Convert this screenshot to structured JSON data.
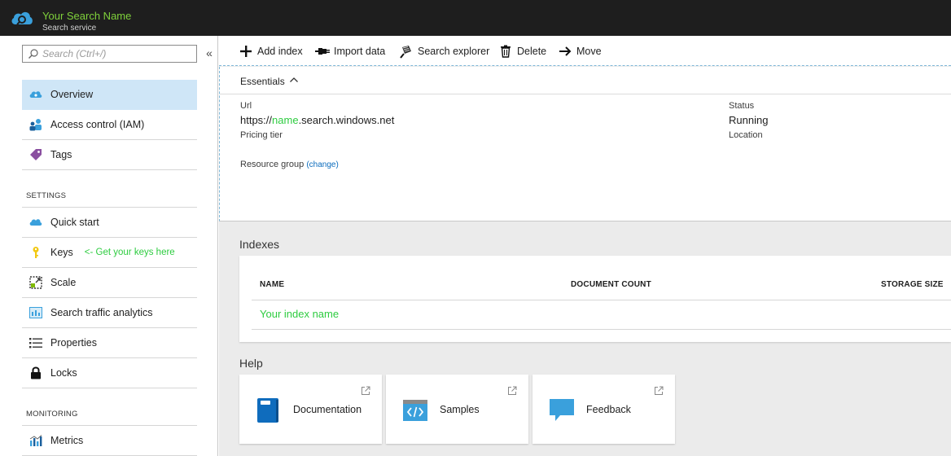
{
  "header": {
    "title": "Your Search Name",
    "subtitle": "Search service"
  },
  "sidebar": {
    "search_placeholder": "Search (Ctrl+/)",
    "collapse_glyph": "«",
    "items_top": [
      {
        "label": "Overview",
        "icon": "cloud-overview-icon"
      },
      {
        "label": "Access control (IAM)",
        "icon": "people-icon"
      },
      {
        "label": "Tags",
        "icon": "tag-icon"
      }
    ],
    "settings_label": "SETTINGS",
    "settings_items": [
      {
        "label": "Quick start",
        "icon": "cloud-quickstart-icon"
      },
      {
        "label": "Keys",
        "icon": "key-icon",
        "hint": "<- Get your keys here"
      },
      {
        "label": "Scale",
        "icon": "scale-icon"
      },
      {
        "label": "Search traffic analytics",
        "icon": "analytics-icon"
      },
      {
        "label": "Properties",
        "icon": "list-icon"
      },
      {
        "label": "Locks",
        "icon": "lock-icon"
      }
    ],
    "monitoring_label": "MONITORING",
    "monitoring_items": [
      {
        "label": "Metrics",
        "icon": "metrics-icon"
      }
    ]
  },
  "toolbar": {
    "add_index": "Add index",
    "import_data": "Import data",
    "search_explorer": "Search explorer",
    "delete": "Delete",
    "move": "Move"
  },
  "essentials": {
    "label": "Essentials",
    "url_label": "Url",
    "url_prefix": "https://",
    "url_name": "name",
    "url_suffix": ".search.windows.net",
    "pricing_tier_label": "Pricing tier",
    "resource_group_label": "Resource group",
    "change_link": "(change)",
    "status_label": "Status",
    "status_value": "Running",
    "location_label": "Location"
  },
  "indexes": {
    "title": "Indexes",
    "columns": [
      "NAME",
      "DOCUMENT COUNT",
      "STORAGE SIZE"
    ],
    "rows": [
      {
        "name": "Your index name"
      }
    ]
  },
  "help": {
    "title": "Help",
    "cards": [
      {
        "label": "Documentation",
        "icon": "book-icon"
      },
      {
        "label": "Samples",
        "icon": "code-icon"
      },
      {
        "label": "Feedback",
        "icon": "speech-bubble-icon"
      }
    ]
  },
  "colors": {
    "accent_green": "#2ecc40",
    "header_bg": "#1e1e1e",
    "active_bg": "#cfe6f7",
    "link_blue": "#0b6cbd"
  }
}
